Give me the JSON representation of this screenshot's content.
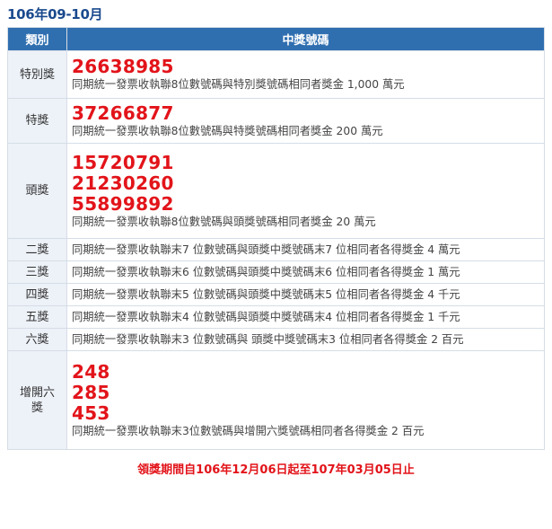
{
  "period_title": "106年09-10月",
  "table": {
    "headers": [
      "類別",
      "中獎號碼"
    ],
    "rows": [
      {
        "category": "特別獎",
        "numbers": [
          "26638985"
        ],
        "description": "同期統一發票收執聯8位數號碼與特別獎號碼相同者獎金 1,000 萬元"
      },
      {
        "category": "特獎",
        "numbers": [
          "37266877"
        ],
        "description": "同期統一發票收執聯8位數號碼與特獎號碼相同者獎金 200 萬元"
      },
      {
        "category": "頭獎",
        "numbers": [
          "15720791",
          "21230260",
          "55899892"
        ],
        "description": "同期統一發票收執聯8位數號碼與頭獎號碼相同者獎金 20 萬元"
      },
      {
        "category": "二獎",
        "numbers": [],
        "description": "同期統一發票收執聯末7 位數號碼與頭獎中獎號碼末7 位相同者各得獎金 4 萬元"
      },
      {
        "category": "三獎",
        "numbers": [],
        "description": "同期統一發票收執聯末6 位數號碼與頭獎中獎號碼末6 位相同者各得獎金 1 萬元"
      },
      {
        "category": "四獎",
        "numbers": [],
        "description": "同期統一發票收執聯末5 位數號碼與頭獎中獎號碼末5 位相同者各得獎金 4 千元"
      },
      {
        "category": "五獎",
        "numbers": [],
        "description": "同期統一發票收執聯末4 位數號碼與頭獎中獎號碼末4 位相同者各得獎金 1 千元"
      },
      {
        "category": "六獎",
        "numbers": [],
        "description": "同期統一發票收執聯末3 位數號碼與 頭獎中獎號碼末3 位相同者各得獎金 2 百元"
      },
      {
        "category": "增開六獎",
        "numbers": [
          "248",
          "285",
          "453"
        ],
        "description": "同期統一發票收執聯末3位數號碼與增開六獎號碼相同者各得獎金 2 百元"
      }
    ]
  },
  "notice": "領獎期間自106年12月06日起至107年03月05日止",
  "colors": {
    "header_bg": "#2f6fb0",
    "accent_red": "#e2141a",
    "title_blue": "#1a4a8e",
    "category_bg": "#edf2f8"
  }
}
